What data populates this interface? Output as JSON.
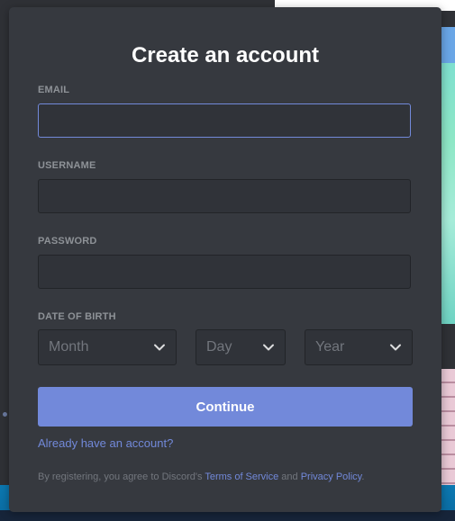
{
  "modal": {
    "title": "Create an account",
    "email": {
      "label": "EMAIL",
      "value": ""
    },
    "username": {
      "label": "USERNAME",
      "value": ""
    },
    "password": {
      "label": "PASSWORD",
      "value": ""
    },
    "dob": {
      "label": "DATE OF BIRTH",
      "month": "Month",
      "day": "Day",
      "year": "Year"
    },
    "continue_label": "Continue",
    "login_link": "Already have an account?",
    "terms": {
      "prefix": "By registering, you agree to Discord's ",
      "tos": "Terms of Service",
      "and": " and ",
      "privacy": "Privacy Policy",
      "suffix": "."
    }
  },
  "colors": {
    "accent": "#7289da",
    "modal_bg": "#36393f",
    "input_bg": "#303339",
    "label": "#8e9297"
  },
  "icons": [
    "chevron-down-icon"
  ]
}
